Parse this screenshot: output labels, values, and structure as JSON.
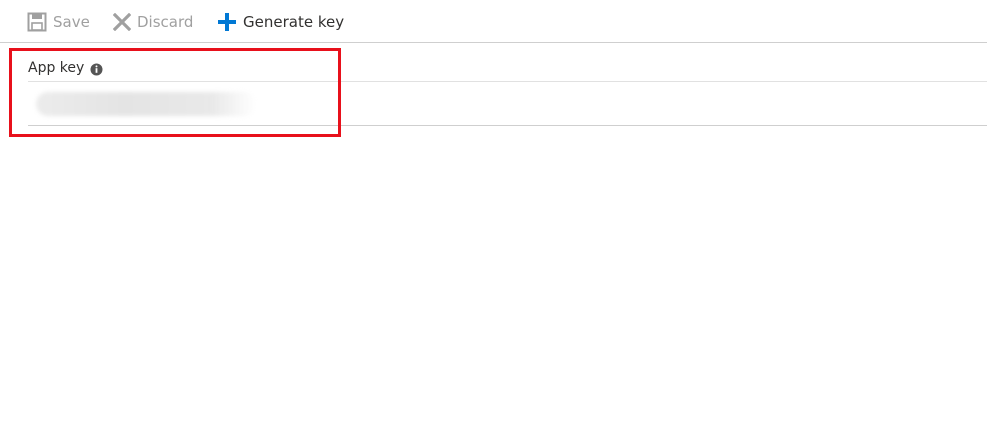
{
  "toolbar": {
    "save_label": "Save",
    "discard_label": "Discard",
    "generate_label": "Generate key"
  },
  "field": {
    "label": "App key",
    "value": ""
  },
  "icons": {
    "save": "save-icon",
    "discard": "close-icon",
    "generate": "plus-icon",
    "info": "info-icon"
  },
  "colors": {
    "accent": "#0078d4",
    "disabled": "#a0a0a0",
    "highlight": "#e8101b"
  }
}
